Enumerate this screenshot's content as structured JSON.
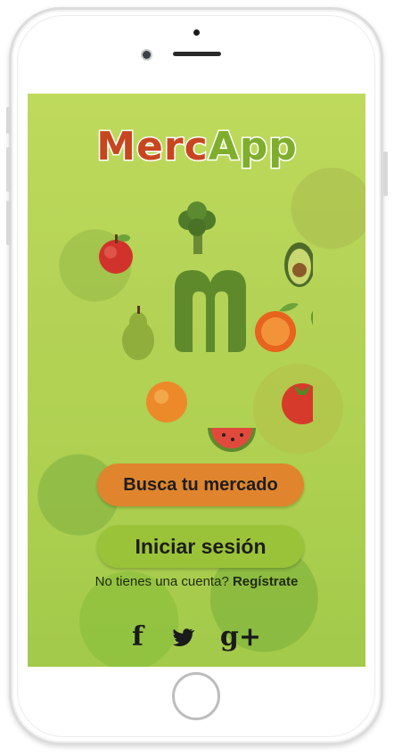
{
  "app": {
    "logo_part1": "Merc",
    "logo_part2": "App"
  },
  "buttons": {
    "search_market": "Busca tu mercado",
    "login": "Iniciar sesión"
  },
  "signup": {
    "prompt": "No tienes una cuenta?",
    "link": "Regístrate"
  },
  "social": {
    "facebook": "f",
    "twitter": "🐦",
    "google_plus": "g+"
  },
  "colors": {
    "logo_red": "#c8461f",
    "logo_green": "#7fae2d",
    "search_button": "#e0852d",
    "login_button": "#9bc339"
  }
}
